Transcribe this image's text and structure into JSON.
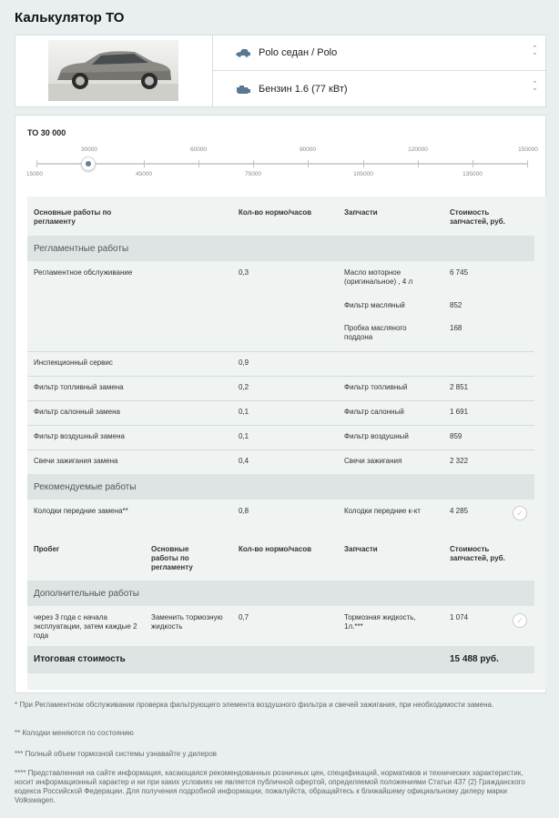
{
  "page": {
    "title": "Калькулятор ТО"
  },
  "car": {
    "model": "Polo седан / Polo",
    "engine": "Бензин 1.6 (77 кВт)"
  },
  "maintenance": {
    "label": "ТО 30 000",
    "selected_mileage": 30000,
    "ticks_top": [
      "30000",
      "60000",
      "90000",
      "120000",
      "150000"
    ],
    "ticks_bottom": [
      "15000",
      "45000",
      "75000",
      "105000",
      "135000"
    ]
  },
  "table": {
    "headers": {
      "works": "Основные работы по регламенту",
      "hours": "Кол-во нормо/часов",
      "parts": "Запчасти",
      "cost": "Стоимость запчастей, руб."
    },
    "section_regular": "Регламентные работы",
    "regular": {
      "service": {
        "name": "Регламентное обслуживание",
        "hours": "0,3"
      },
      "parts": [
        {
          "name": "Масло моторное (оригинальное) , 4 л",
          "cost": "6 745"
        },
        {
          "name": "Фильтр масляный",
          "cost": "852"
        },
        {
          "name": "Пробка масляного поддона",
          "cost": "168"
        }
      ]
    },
    "rows": [
      {
        "work": "Инспекционный сервис",
        "hours": "0,9",
        "part": "",
        "cost": ""
      },
      {
        "work": "Фильтр топливный замена",
        "hours": "0,2",
        "part": "Фильтр топливный",
        "cost": "2 851"
      },
      {
        "work": "Фильтр салонный замена",
        "hours": "0,1",
        "part": "Фильтр салонный",
        "cost": "1 691"
      },
      {
        "work": "Фильтр воздушный замена",
        "hours": "0,1",
        "part": "Фильтр воздушный",
        "cost": "859"
      },
      {
        "work": "Свечи зажигания замена",
        "hours": "0,4",
        "part": "Свечи зажигания",
        "cost": "2 322"
      }
    ],
    "section_recommended": "Рекомендуемые работы",
    "recommended": {
      "work": "Колодки передние замена**",
      "hours": "0,8",
      "part": "Колодки передние к-кт",
      "cost": "4 285"
    },
    "headers2": {
      "mileage": "Пробег",
      "works": "Основные работы по регламенту",
      "hours": "Кол-во нормо/часов",
      "parts": "Запчасти",
      "cost": "Стоимость запчастей, руб."
    },
    "section_additional": "Дополнительные работы",
    "additional": {
      "mileage": "через 3 года с начала эксплуатации, затем каждые 2 года",
      "work": "Заменить тормозную жидкость",
      "hours": "0,7",
      "part": "Тормозная жидкость, 1л.***",
      "cost": "1 074"
    },
    "total_label": "Итоговая стоимость",
    "total_value": "15 488 руб."
  },
  "footnotes": [
    "* При Регламентном обслуживании проверка фильтрующего элемента воздушного фильтра и свечей зажигания, при необходимости замена.",
    "** Колодки меняются по состоянию",
    "*** Полный объем тормозной системы узнавайте у дилеров",
    "**** Представленная на сайте информация, касающаяся рекомендованных розничных цен, спецификаций, нормативов и технических характеристик, носит информационный характер и ни при каких условиях не является публичной офертой, определяемой положениями Статьи 437 (2) Гражданского кодекса Российской Федерации. Для получения подробной информации, пожалуйста, обращайтесь к ближайшему официальному дилеру марки Volkswagen."
  ],
  "colors": {
    "background": "#e9eeee",
    "band": "#dde4e3",
    "knob": "#6b7f8c",
    "icon": "#5a7891"
  },
  "icons": {
    "model": "car-icon",
    "engine": "engine-icon",
    "select": "chevron-updown-icon",
    "check": "check-circle-icon"
  }
}
